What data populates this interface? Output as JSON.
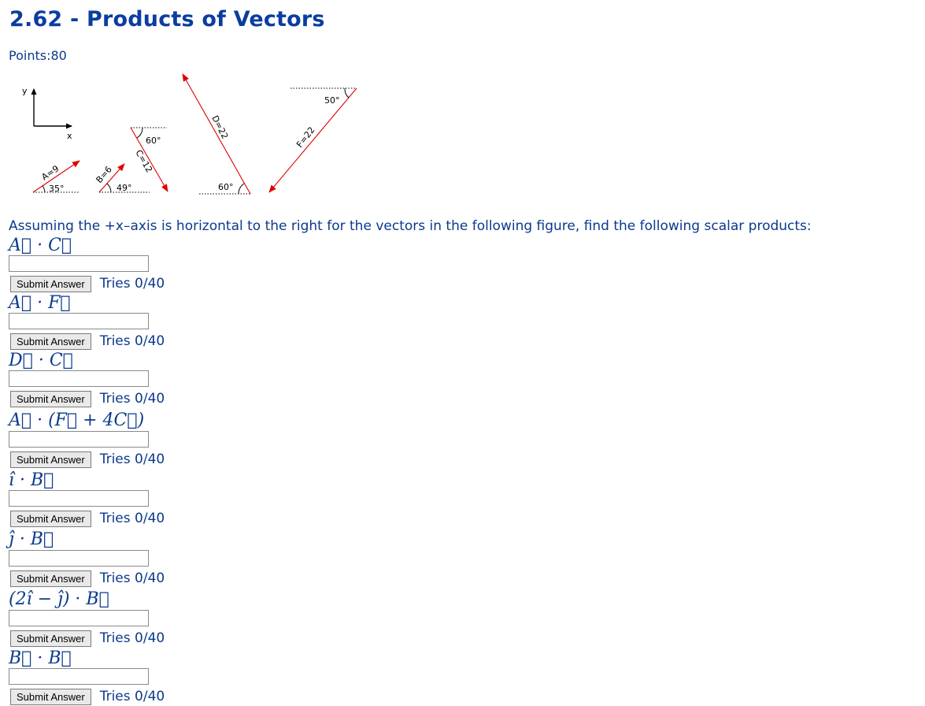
{
  "page": {
    "title": "2.62 - Products of Vectors",
    "points": "Points:80",
    "prompt": "Assuming the +x–axis is horizontal to the right for the vectors in the following figure, find the following scalar products:"
  },
  "figure": {
    "axis_y": "y",
    "axis_x": "x",
    "vectors": [
      {
        "label": "A=9",
        "angle": "35°"
      },
      {
        "label": "B=6",
        "angle": "49°"
      },
      {
        "label": "C=12",
        "angle": "60°"
      },
      {
        "label": "D=22",
        "angle": "60°"
      },
      {
        "label": "F=22",
        "angle": "50°"
      }
    ],
    "arrow_color": "#e00000"
  },
  "questions": [
    {
      "expr": "A⃗ · C⃗",
      "value": "",
      "submit_label": "Submit Answer",
      "tries": "Tries 0/40"
    },
    {
      "expr": "A⃗ · F⃗",
      "value": "",
      "submit_label": "Submit Answer",
      "tries": "Tries 0/40"
    },
    {
      "expr": "D⃗ · C⃗",
      "value": "",
      "submit_label": "Submit Answer",
      "tries": "Tries 0/40"
    },
    {
      "expr": "A⃗ · (F⃗ + 4C⃗)",
      "value": "",
      "submit_label": "Submit Answer",
      "tries": "Tries 0/40"
    },
    {
      "expr": "î · B⃗",
      "value": "",
      "submit_label": "Submit Answer",
      "tries": "Tries 0/40"
    },
    {
      "expr": "ĵ · B⃗",
      "value": "",
      "submit_label": "Submit Answer",
      "tries": "Tries 0/40"
    },
    {
      "expr": "(2î − ĵ) · B⃗",
      "value": "",
      "submit_label": "Submit Answer",
      "tries": "Tries 0/40"
    },
    {
      "expr": "B⃗ · B⃗",
      "value": "",
      "submit_label": "Submit Answer",
      "tries": "Tries 0/40"
    }
  ]
}
